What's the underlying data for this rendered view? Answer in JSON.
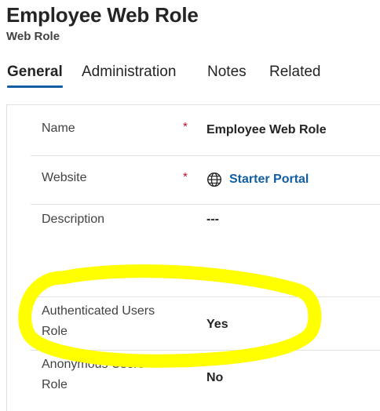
{
  "header": {
    "title": "Employee Web Role",
    "subtitle": "Web Role"
  },
  "tabs": [
    {
      "label": "General",
      "active": true
    },
    {
      "label": "Administration",
      "active": false
    },
    {
      "label": "Notes",
      "active": false
    },
    {
      "label": "Related",
      "active": false
    }
  ],
  "form": {
    "name": {
      "label": "Name",
      "required_marker": "*",
      "value": "Employee Web Role"
    },
    "website": {
      "label": "Website",
      "required_marker": "*",
      "value": "Starter Portal",
      "icon": "globe-icon"
    },
    "description": {
      "label": "Description",
      "value": "---"
    },
    "authenticated_users_role": {
      "label_line1": "Authenticated Users",
      "label_line2": "Role",
      "value": "Yes"
    },
    "anonymous_users_role": {
      "label_line1": "Anonymous Users",
      "label_line2": "Role",
      "value": "No"
    }
  },
  "colors": {
    "accent": "#115ea3",
    "required": "#c50f1f",
    "highlight_marker": "#ffff00"
  }
}
